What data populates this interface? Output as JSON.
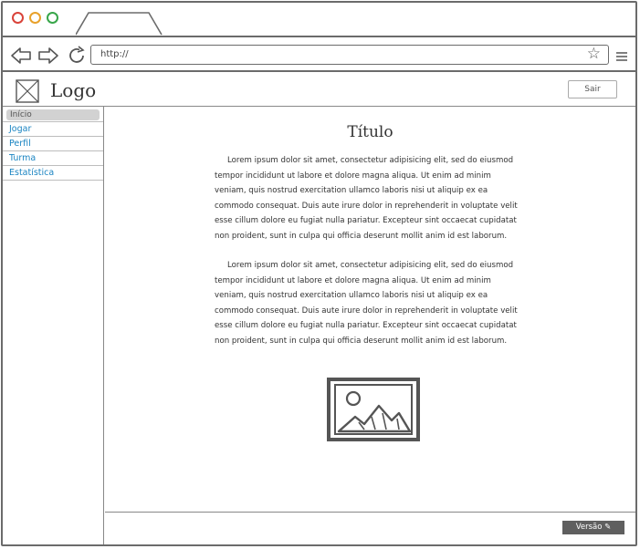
{
  "browser": {
    "url": "http://",
    "traffic_colors": [
      "#e0413a",
      "#f0a830",
      "#3ab34a"
    ]
  },
  "header": {
    "logo_text": "Logo",
    "logout_label": "Sair"
  },
  "sidebar": {
    "items": [
      {
        "label": "Início",
        "active": true
      },
      {
        "label": "Jogar"
      },
      {
        "label": "Perfil"
      },
      {
        "label": "Turma"
      },
      {
        "label": "Estatística"
      }
    ]
  },
  "main": {
    "title": "Título",
    "paragraphs": [
      "Lorem ipsum dolor sit amet, consectetur adipisicing elit, sed do eiusmod tempor incididunt ut labore et dolore magna aliqua. Ut enim ad minim veniam, quis nostrud exercitation ullamco laboris nisi ut aliquip ex ea commodo consequat. Duis aute irure dolor in reprehenderit in voluptate velit esse cillum dolore eu fugiat nulla pariatur. Excepteur sint occaecat cupidatat non proident, sunt in culpa qui officia deserunt mollit anim id est laborum.",
      "Lorem ipsum dolor sit amet, consectetur adipisicing elit, sed do eiusmod tempor incididunt ut labore et dolore magna aliqua. Ut enim ad minim veniam, quis nostrud exercitation ullamco laboris nisi ut aliquip ex ea commodo consequat. Duis aute irure dolor in reprehenderit in voluptate velit esse cillum dolore eu fugiat nulla pariatur. Excepteur sint occaecat cupidatat non proident, sunt in culpa qui officia deserunt mollit anim id est laborum."
    ]
  },
  "footer": {
    "version_label": "Versão ✎"
  }
}
